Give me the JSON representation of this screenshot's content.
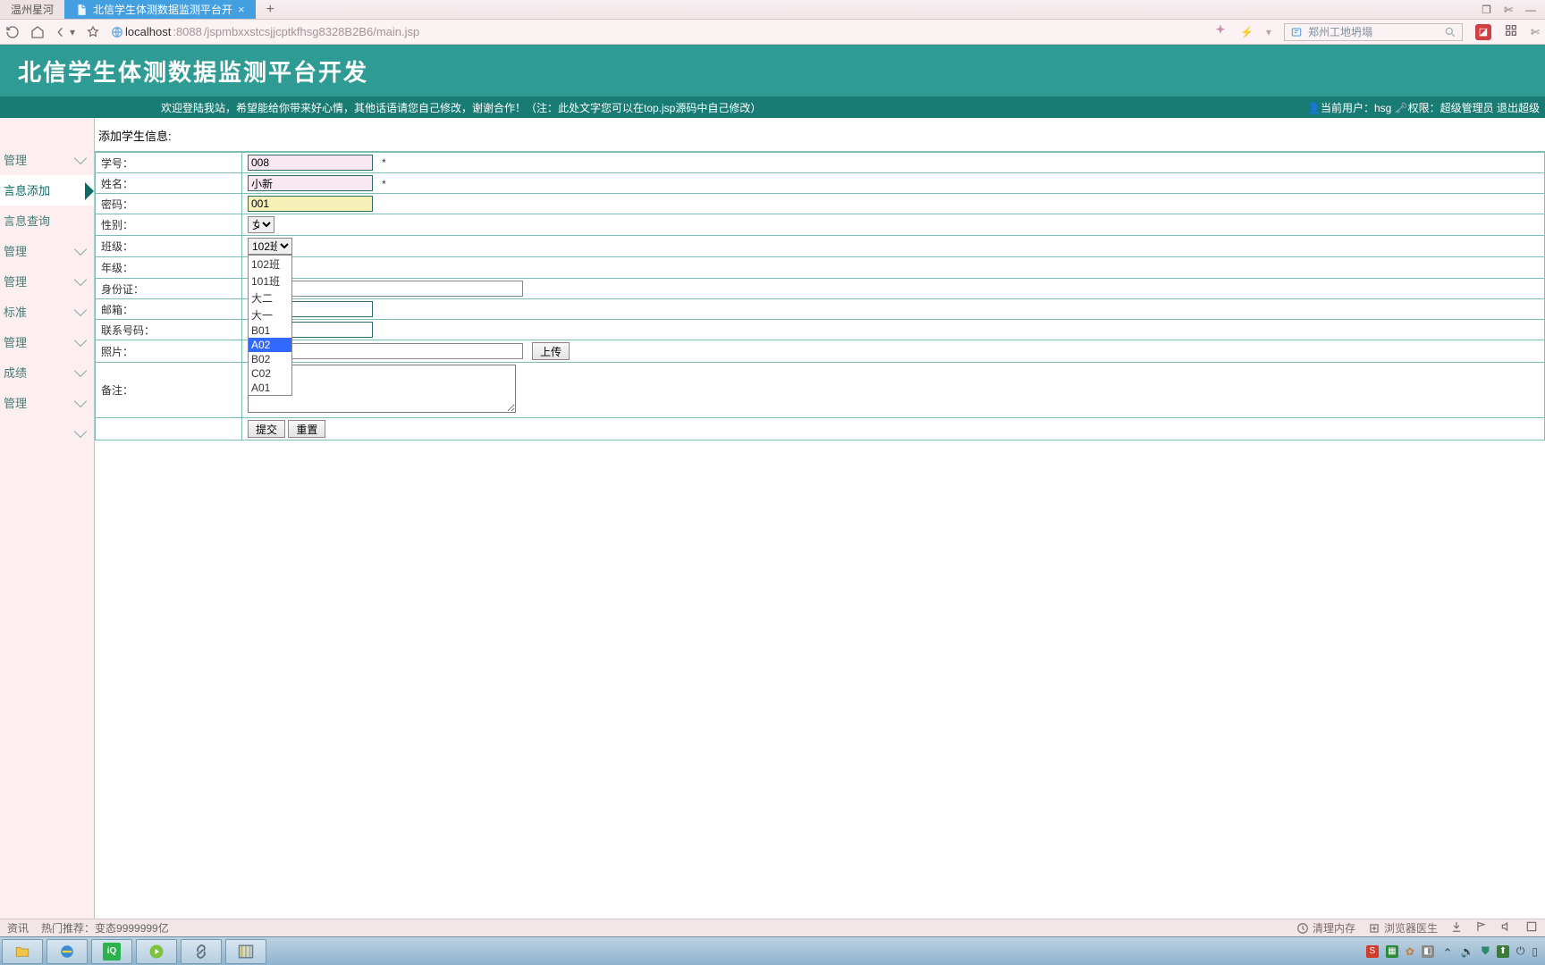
{
  "chrome": {
    "tab_inactive": "温州星河",
    "tab_active": "北信学生体测数据监测平台开",
    "url_host_dim": "localhost",
    "url_host": ":8088",
    "url_path": "/jspmbxxstcsjjcptkfhsg8328B2B6/main.jsp",
    "location_hint": "郑州工地坍塌",
    "win_restore": "❐",
    "win_scissors": "✄"
  },
  "header": {
    "title": "北信学生体测数据监测平台开发",
    "welcome": "欢迎登陆我站，希望能给你带来好心情，其他话语请您自己修改，谢谢合作！（注：此处文字您可以在top.jsp源码中自己修改）",
    "user_prefix": "当前用户：",
    "user": "hsg",
    "perm_prefix": "权限：",
    "perm": "超级管理员",
    "logout": "退出超级"
  },
  "sidebar": {
    "items": [
      {
        "label": "管理"
      },
      {
        "label": "言息添加"
      },
      {
        "label": "言息查询"
      },
      {
        "label": "管理"
      },
      {
        "label": "管理"
      },
      {
        "label": "标准"
      },
      {
        "label": "管理"
      },
      {
        "label": "成绩"
      },
      {
        "label": "管理"
      },
      {
        "label": ""
      }
    ]
  },
  "form": {
    "page_title": "添加学生信息:",
    "labels": {
      "studentId": "学号：",
      "name": "姓名：",
      "password": "密码：",
      "gender": "性别：",
      "class": "班级：",
      "grade": "年级：",
      "idcard": "身份证：",
      "email": "邮箱：",
      "phone": "联系号码：",
      "photo": "照片：",
      "notes": "备注："
    },
    "values": {
      "studentId": "008",
      "name": "小新",
      "password": "001",
      "gender": "女",
      "class": "102班",
      "grade": "",
      "idcard": "",
      "email": "",
      "phone": "",
      "photo": "",
      "notes": ""
    },
    "classOptions": [
      "102班",
      "101班",
      "大二",
      "大一",
      "B01",
      "A02",
      "B02",
      "C02",
      "A01"
    ],
    "classHighlighted": "A02",
    "required_mark": "*",
    "upload_btn": "上传",
    "submit_btn": "提交",
    "reset_btn": "重置"
  },
  "statusbar": {
    "left1": "资讯",
    "left2": "热门推荐：变态9999999亿",
    "clear_cache": "清理内存",
    "doctor": "浏览器医生"
  },
  "taskbar": {
    "sogou": "S"
  }
}
